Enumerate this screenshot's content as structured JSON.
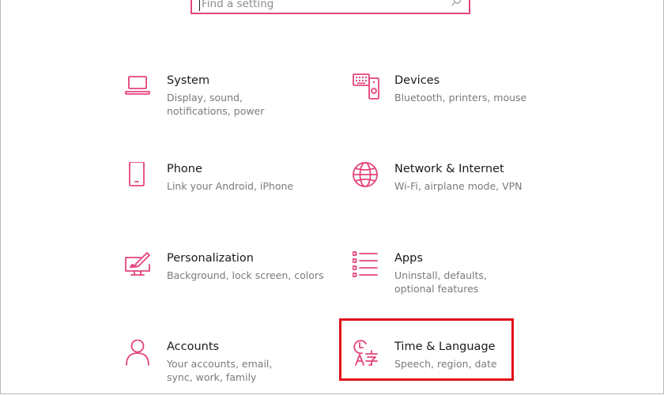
{
  "search": {
    "placeholder": "Find a setting"
  },
  "categories": [
    {
      "id": "system",
      "title": "System",
      "desc": "Display, sound, notifications, power",
      "icon": "laptop-icon"
    },
    {
      "id": "devices",
      "title": "Devices",
      "desc": "Bluetooth, printers, mouse",
      "icon": "devices-icon"
    },
    {
      "id": "phone",
      "title": "Phone",
      "desc": "Link your Android, iPhone",
      "icon": "phone-icon"
    },
    {
      "id": "network",
      "title": "Network & Internet",
      "desc": "Wi-Fi, airplane mode, VPN",
      "icon": "globe-icon"
    },
    {
      "id": "personalization",
      "title": "Personalization",
      "desc": "Background, lock screen, colors",
      "icon": "paint-icon"
    },
    {
      "id": "apps",
      "title": "Apps",
      "desc": "Uninstall, defaults, optional features",
      "icon": "apps-list-icon"
    },
    {
      "id": "accounts",
      "title": "Accounts",
      "desc": "Your accounts, email, sync, work, family",
      "icon": "person-icon"
    },
    {
      "id": "time",
      "title": "Time & Language",
      "desc": "Speech, region, date",
      "icon": "time-language-icon"
    }
  ],
  "colors": {
    "accent": "#e4447e",
    "highlight_border": "#e0101a"
  }
}
